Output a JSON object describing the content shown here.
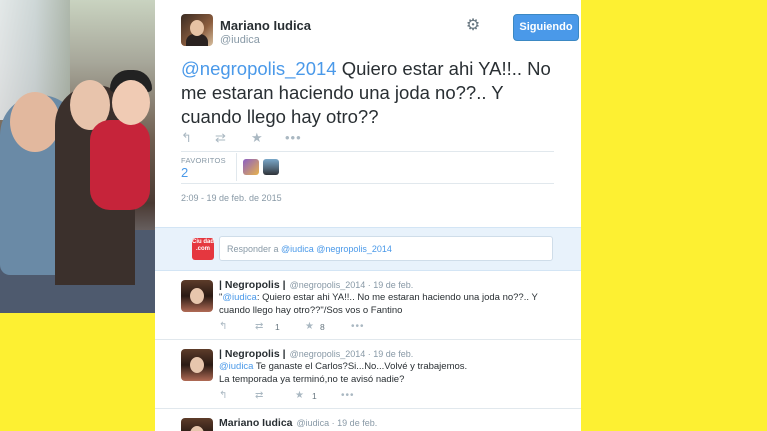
{
  "tweet": {
    "author_name": "Mariano Iudica",
    "author_handle": "@iudica",
    "follow_label": "Siguiendo",
    "text_mention": "@negropolis_2014",
    "text_body": " Quiero estar ahi YA!!.. No me estaran haciendo una joda no??.. Y cuando llego hay otro??",
    "favorites_label": "FAVORITOS",
    "favorites_count": "2",
    "timestamp": "2:09 - 19 de feb. de 2015"
  },
  "reply_box": {
    "logo_text": "Ciu dad .com",
    "prefix": "Responder a ",
    "mentions": "@iudica @negropolis_2014"
  },
  "replies": [
    {
      "name": "| Negropolis |",
      "handle": "@negropolis_2014",
      "date": "19 de feb.",
      "pre": "\"",
      "mention": "@iudica",
      "text": ":  Quiero estar ahi YA!!.. No me estaran haciendo una joda no??.. Y cuando llego hay otro??\"/Sos vos o Fantino",
      "retweets": "1",
      "favorites": "8"
    },
    {
      "name": "| Negropolis |",
      "handle": "@negropolis_2014",
      "date": "19 de feb.",
      "pre": "",
      "mention": "@iudica",
      "text": " Te ganaste el Carlos?Si...No...Volvé y trabajemos. La temporada ya terminó,no te avisó nadie?",
      "retweets": "",
      "favorites": "1"
    },
    {
      "name": "Mariano Iudica",
      "handle": "@iudica",
      "date": "19 de feb.",
      "pre": "",
      "mention": "",
      "text": "",
      "retweets": "",
      "favorites": ""
    }
  ],
  "icons": {
    "reply": "reply-icon",
    "retweet": "retweet-icon",
    "favorite": "star-icon",
    "more": "more-icon",
    "settings": "gear-icon"
  },
  "colors": {
    "background": "#FDF032",
    "accent": "#4A99E9"
  }
}
